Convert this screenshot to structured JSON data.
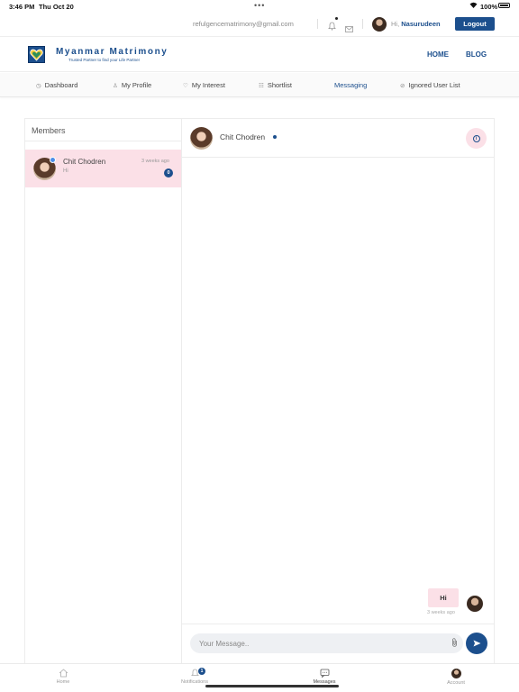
{
  "status_bar": {
    "time": "3:46 PM",
    "date": "Thu Oct 20",
    "battery": "100%"
  },
  "account_bar": {
    "email": "refulgencematrimony@gmail.com",
    "greeting": "Hi,",
    "user_name": "Nasurudeen",
    "logout_label": "Logout"
  },
  "brand": {
    "name": "Myanmar Matrimony",
    "tagline": "Trusted Partner to find your Life Partner",
    "color": "#1c4f8d"
  },
  "header_nav": {
    "home": "HOME",
    "blog": "BLOG"
  },
  "menu": {
    "items": [
      {
        "label": "Dashboard",
        "icon": "clock-icon"
      },
      {
        "label": "My Profile",
        "icon": "user-icon"
      },
      {
        "label": "My Interest",
        "icon": "heart-icon"
      },
      {
        "label": "Shortlist",
        "icon": "list-icon"
      },
      {
        "label": "Messaging",
        "icon": "message-icon"
      },
      {
        "label": "Ignored User List",
        "icon": "block-icon"
      }
    ],
    "active": "Messaging"
  },
  "members": {
    "title": "Members",
    "items": [
      {
        "name": "Chit Chodren",
        "last_message": "Hi",
        "time": "3 weeks ago",
        "unread": "0",
        "online": true
      }
    ]
  },
  "chat": {
    "contact_name": "Chit Chodren",
    "messages": [
      {
        "text": "Hi",
        "time": "3 weeks ago",
        "from": "me"
      }
    ],
    "compose_placeholder": "Your Message.."
  },
  "tab_bar": {
    "items": [
      {
        "label": "Home",
        "icon": "home-icon"
      },
      {
        "label": "Notifications",
        "icon": "bell-icon",
        "badge": "1"
      },
      {
        "label": "Messages",
        "icon": "chat-icon"
      },
      {
        "label": "Account",
        "icon": "avatar-icon"
      }
    ],
    "active": "Messages"
  },
  "colors": {
    "accent": "#1c4f8d",
    "highlight": "#fbe0e7",
    "online": "#4c8ee8"
  }
}
